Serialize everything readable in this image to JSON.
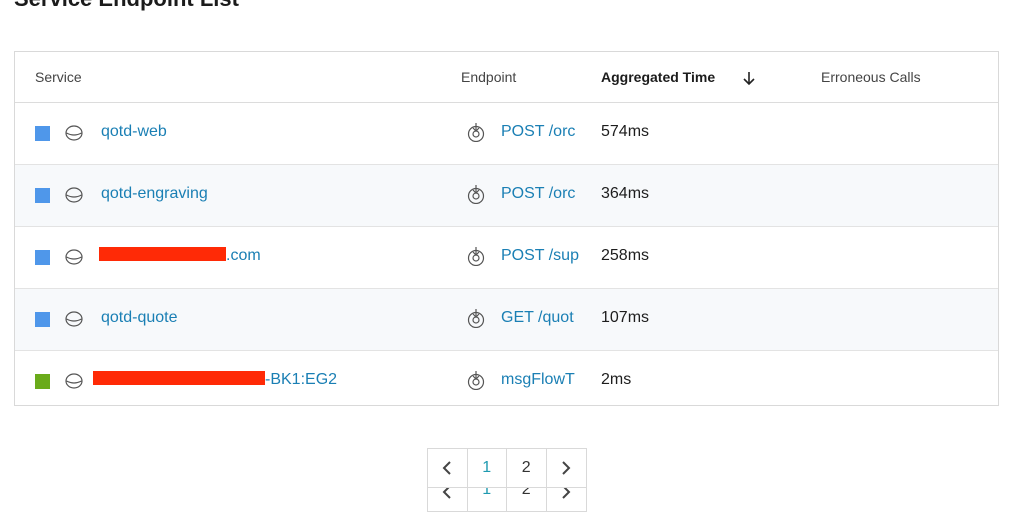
{
  "page": {
    "title": "Service Endpoint List"
  },
  "table": {
    "headers": {
      "service": "Service",
      "endpoint": "Endpoint",
      "aggregated_time": "Aggregated Time",
      "erroneous_calls": "Erroneous Calls"
    },
    "sort": {
      "column": "Aggregated Time",
      "direction": "descending"
    },
    "rows": [
      {
        "swatch_color": "#4f97ea",
        "service_text": "qotd-web",
        "service_suffix": "",
        "redacted": false,
        "endpoint": "POST /orc",
        "aggregated_time": "574ms",
        "erroneous_calls": ""
      },
      {
        "swatch_color": "#4f97ea",
        "service_text": "qotd-engraving",
        "service_suffix": "",
        "redacted": false,
        "endpoint": "POST /orc",
        "aggregated_time": "364ms",
        "erroneous_calls": ""
      },
      {
        "swatch_color": "#4f97ea",
        "service_text": "",
        "service_suffix": ".com",
        "redacted": true,
        "endpoint": "POST /sup",
        "aggregated_time": "258ms",
        "erroneous_calls": ""
      },
      {
        "swatch_color": "#4f97ea",
        "service_text": "qotd-quote",
        "service_suffix": "",
        "redacted": false,
        "endpoint": "GET /quot",
        "aggregated_time": "107ms",
        "erroneous_calls": ""
      },
      {
        "swatch_color": "#6aab1a",
        "service_text": "",
        "service_suffix": "-BK1:EG2",
        "redacted": true,
        "endpoint": "msgFlowT",
        "aggregated_time": "2ms",
        "erroneous_calls": ""
      }
    ]
  },
  "pagination": {
    "pages": [
      "1",
      "2"
    ],
    "current_page": "1",
    "prev_icon": "chevron-left-icon",
    "next_icon": "chevron-right-icon"
  },
  "icons": {
    "service": "database-icon",
    "endpoint": "endpoint-icon",
    "sort": "arrow-down-icon"
  },
  "colors": {
    "link": "#1a7fb4",
    "redaction": "#ff2a06",
    "active_page": "#1f9ab0"
  }
}
